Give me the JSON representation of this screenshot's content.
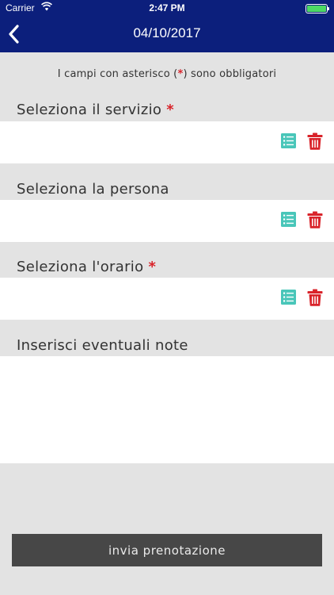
{
  "status_bar": {
    "carrier": "Carrier",
    "time": "2:47 PM",
    "battery_level": 1.0
  },
  "navbar": {
    "title": "04/10/2017",
    "back_icon": "chevron-left-icon",
    "background_color": "#0c1f7c"
  },
  "notice": {
    "before": "I campi con asterisco (",
    "star": "*",
    "after": ") sono obbligatori"
  },
  "fields": [
    {
      "label": "Seleziona il servizio",
      "required": true,
      "required_mark": "*",
      "value": ""
    },
    {
      "label": "Seleziona la persona",
      "required": false,
      "value": ""
    },
    {
      "label": "Seleziona l'orario",
      "required": true,
      "required_mark": "*",
      "value": ""
    }
  ],
  "notes": {
    "label": "Inserisci eventuali note",
    "value": ""
  },
  "submit": {
    "label": "invia prenotazione"
  },
  "colors": {
    "list_icon": "#49c6b9",
    "trash_icon": "#d9232a",
    "required_star": "#d9232a",
    "button_bg": "#474747"
  }
}
